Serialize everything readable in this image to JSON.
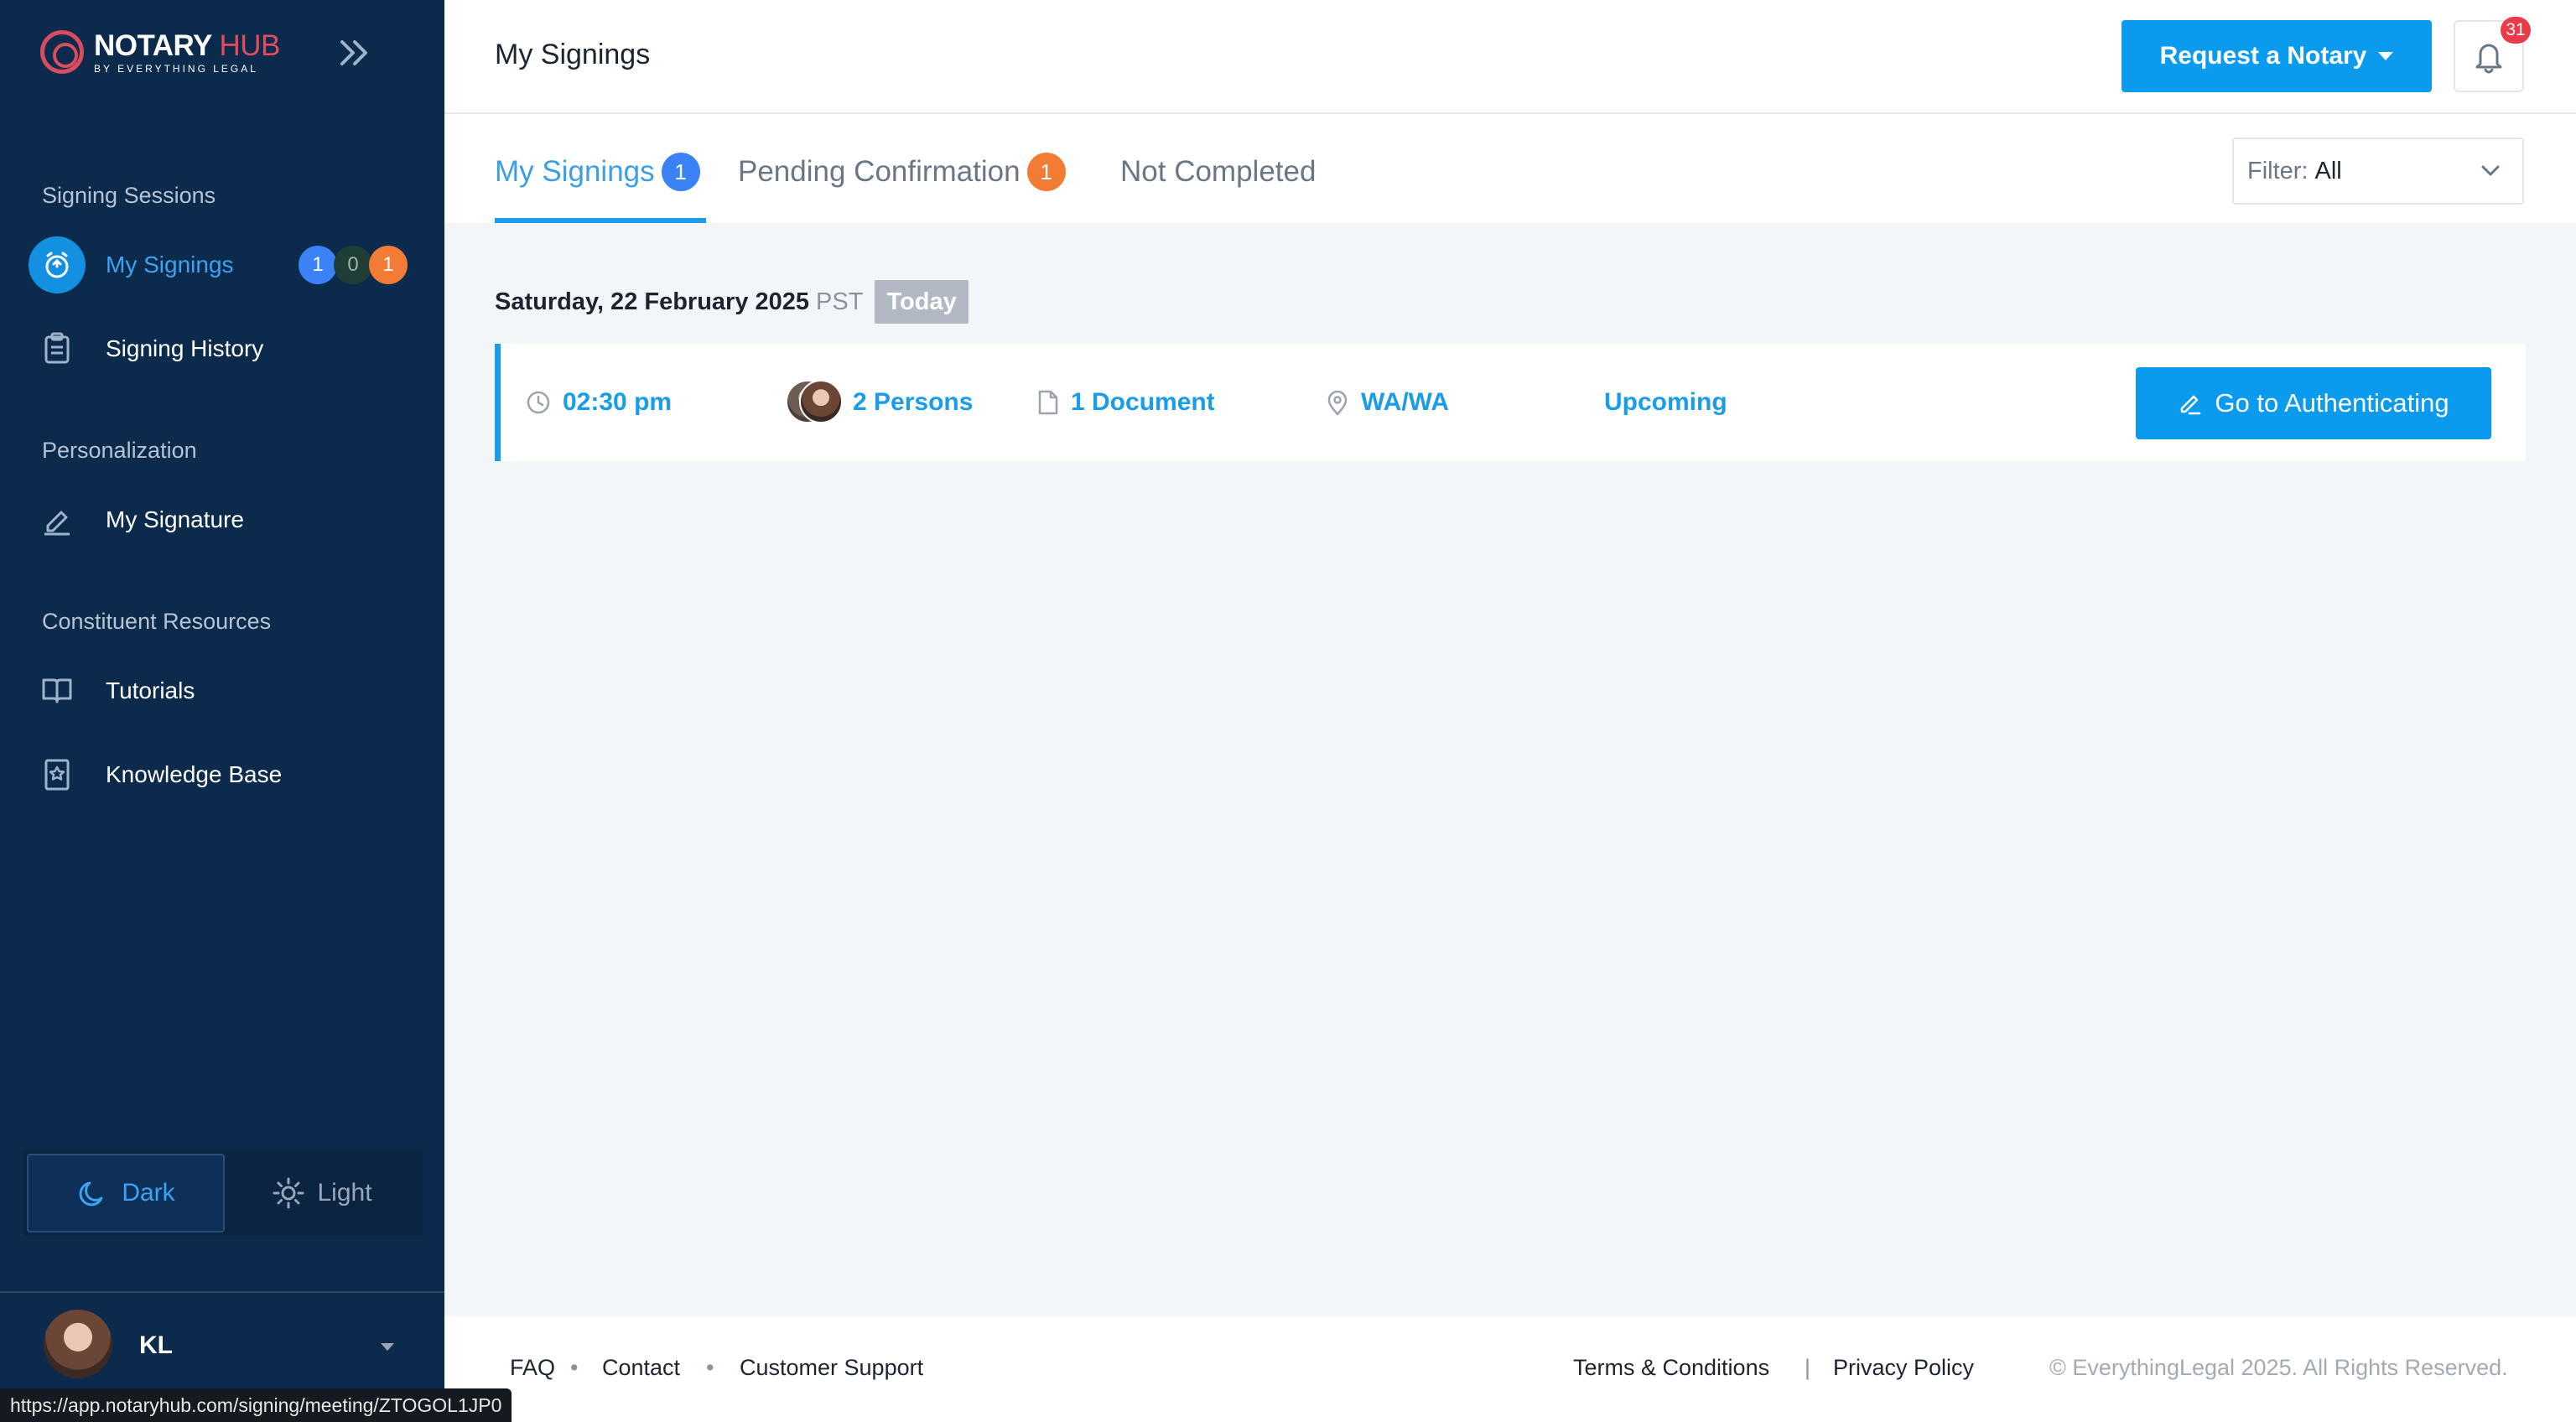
{
  "brand": {
    "name_main": "NOTARY",
    "name_accent": "HUB",
    "tagline": "BY EVERYTHING LEGAL"
  },
  "header": {
    "title": "My Signings",
    "request_label": "Request a Notary",
    "notification_count": "31"
  },
  "sidebar": {
    "sections": [
      "Signing Sessions",
      "Personalization",
      "Constituent Resources"
    ],
    "items": [
      {
        "label": "My Signings",
        "icon": "alarm-icon",
        "active": true
      },
      {
        "label": "Signing History",
        "icon": "clipboard-icon"
      },
      {
        "label": "My Signature",
        "icon": "pen-icon"
      },
      {
        "label": "Tutorials",
        "icon": "book-icon"
      },
      {
        "label": "Knowledge Base",
        "icon": "bookmark-icon"
      }
    ],
    "my_signings_badges": [
      "1",
      "0",
      "1"
    ],
    "badge_colors": [
      "#3b82f6",
      "#1f3f36",
      "#f27c36"
    ]
  },
  "theme": {
    "dark_label": "Dark",
    "light_label": "Light"
  },
  "user": {
    "initials": "KL"
  },
  "status_url": "https://app.notaryhub.com/signing/meeting/ZTOGOL1JP0",
  "tabs": [
    {
      "label": "My Signings",
      "count": "1"
    },
    {
      "label": "Pending Confirmation",
      "count": "1"
    },
    {
      "label": "Not Completed"
    }
  ],
  "filter": {
    "label": "Filter:",
    "value": "All"
  },
  "sessions": {
    "date": "Saturday, 22 February 2025",
    "timezone": "PST",
    "today_label": "Today",
    "items": [
      {
        "time": "02:30 pm",
        "persons": "2 Persons",
        "documents": "1 Document",
        "location": "WA/WA",
        "status": "Upcoming",
        "action_label": "Go to Authenticating"
      }
    ]
  },
  "footer": {
    "links_left": [
      "FAQ",
      "Contact",
      "Customer Support"
    ],
    "links_right": [
      "Terms & Conditions",
      "Privacy Policy"
    ],
    "copyright": "© EverythingLegal 2025. All Rights Reserved."
  },
  "colors": {
    "sidebar_bg": "#0c2a4b",
    "accent": "#0a9bef",
    "orange_badge": "#f27c36",
    "blue_badge": "#3b82f6",
    "alert_red": "#ea3b48"
  }
}
